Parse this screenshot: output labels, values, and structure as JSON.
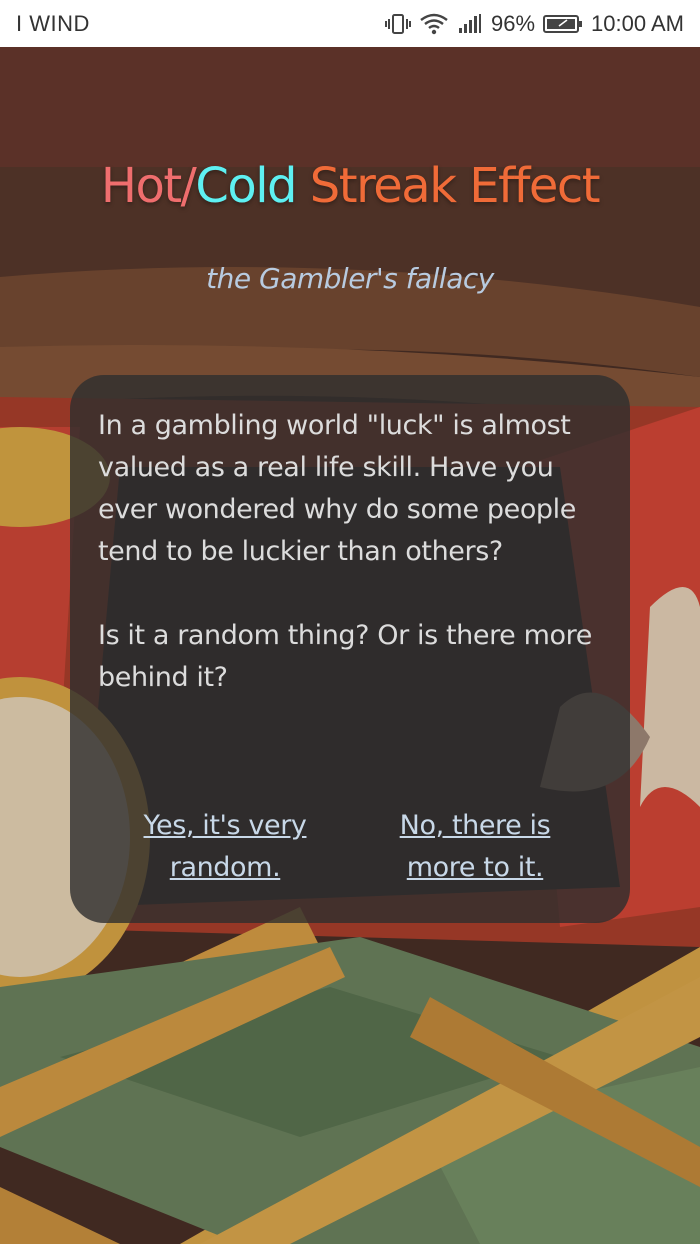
{
  "status_bar": {
    "carrier": "I WIND",
    "battery_percent": "96%",
    "time": "10:00 AM",
    "icons": [
      "vibrate-icon",
      "wifi-icon",
      "signal-icon",
      "battery-icon"
    ]
  },
  "header": {
    "title_hot": "Hot/",
    "title_cold": "Cold",
    "title_rest": " Streak Effect",
    "subtitle": "the Gambler's fallacy"
  },
  "card": {
    "paragraph1": "In a gambling world \"luck\" is almost valued as a real life skill. Have you ever wondered why do some people tend to be luckier than others?",
    "paragraph2": "Is it a random thing? Or is there more behind it?",
    "choice_yes": "Yes, it's very random.",
    "choice_no": "No, there is more to it."
  },
  "colors": {
    "hot": "#ef6e6e",
    "cold": "#5ef0f2",
    "streak": "#f06b38",
    "subtitle": "#b8cbe0",
    "body_text": "#dcdcdc",
    "link_text": "#c8d8e8",
    "card_bg": "#2e2e2e"
  }
}
